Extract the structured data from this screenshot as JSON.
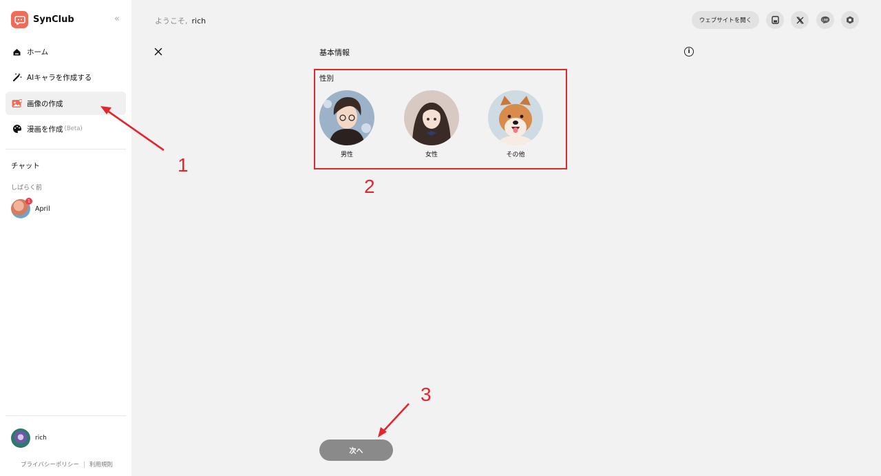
{
  "sidebar": {
    "brand": "SynClub",
    "nav": [
      {
        "label": "ホーム",
        "icon": "home-icon"
      },
      {
        "label": "AIキャラを作成する",
        "icon": "magic-wand-icon"
      },
      {
        "label": "画像の作成",
        "icon": "image-create-icon"
      },
      {
        "label": "漫画を作成",
        "beta": "(Beta)",
        "icon": "palette-icon"
      }
    ],
    "chat_title": "チャット",
    "recent_label": "しばらく前",
    "chats": [
      {
        "name": "April",
        "badge": "1"
      }
    ],
    "user_name": "rich",
    "footer": {
      "privacy": "プライバシーポリシー",
      "terms": "利用規則"
    }
  },
  "header": {
    "welcome": "ようこそ,",
    "username": "rich",
    "open_site": "ウェブサイトを開く"
  },
  "panel": {
    "title": "基本情報",
    "gender_label": "性別",
    "options": [
      {
        "label": "男性"
      },
      {
        "label": "女性"
      },
      {
        "label": "その他"
      }
    ],
    "next": "次へ"
  },
  "annotations": {
    "one": "1",
    "two": "2",
    "three": "3",
    "color": "#e3262e"
  },
  "colors": {
    "accent": "#f26b57",
    "highlight": "#e3262e",
    "button": "#8a8a8a"
  }
}
